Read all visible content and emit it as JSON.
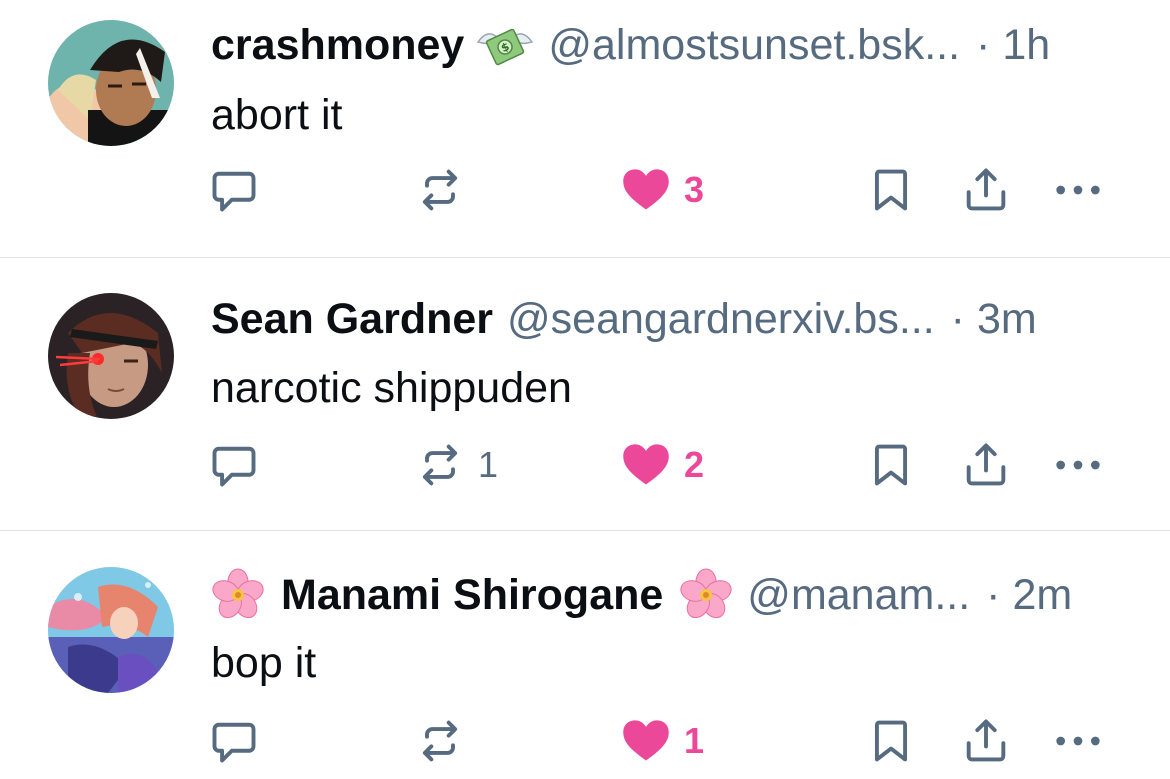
{
  "colors": {
    "text": "#0b0f14",
    "muted": "#566a80",
    "icon": "#566a80",
    "like": "#ec4899",
    "divider": "#dfe3e8"
  },
  "posts": [
    {
      "name": "crashmoney",
      "badge_icon": "flying-money-emoji",
      "handle": "@almostsunset.bsk...",
      "time": "· 1h",
      "text": "abort it",
      "reply_count": "",
      "repost_count": "",
      "like_count": "3",
      "liked": true
    },
    {
      "name": "Sean Gardner",
      "handle": "@seangardnerxiv.bs...",
      "time": "· 3m",
      "text": "narcotic shippuden",
      "reply_count": "",
      "repost_count": "1",
      "like_count": "2",
      "liked": true
    },
    {
      "name": "Manami Shirogane",
      "name_prefix_icon": "cherry-blossom-emoji",
      "name_suffix_icon": "cherry-blossom-emoji",
      "handle": "@manam...",
      "time": "· 2m",
      "text": "bop it",
      "reply_count": "",
      "repost_count": "",
      "like_count": "1",
      "liked": true
    }
  ]
}
